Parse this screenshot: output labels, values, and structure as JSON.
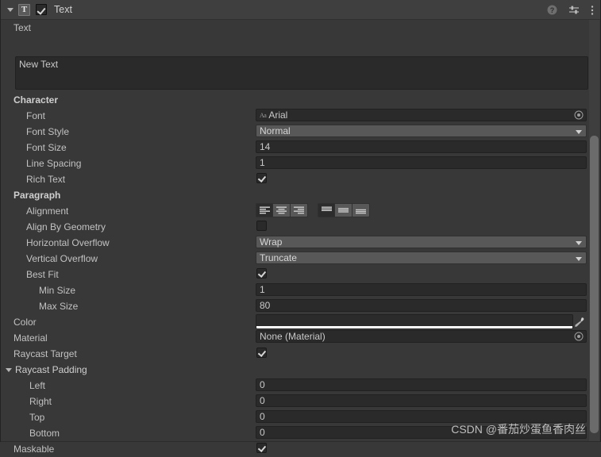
{
  "component": {
    "title": "Text",
    "icon_label": "T",
    "enabled": true,
    "expanded": true,
    "header_icons": [
      "help-icon",
      "preset-icon",
      "more-options-icon"
    ]
  },
  "text_block": {
    "label": "Text",
    "value": "New Text"
  },
  "sections": {
    "character": {
      "title": "Character",
      "font": {
        "label": "Font",
        "value": "Arial",
        "icon": "font-asset-icon"
      },
      "font_style": {
        "label": "Font Style",
        "value": "Normal"
      },
      "font_size": {
        "label": "Font Size",
        "value": "14"
      },
      "line_spacing": {
        "label": "Line Spacing",
        "value": "1"
      },
      "rich_text": {
        "label": "Rich Text",
        "checked": true
      }
    },
    "paragraph": {
      "title": "Paragraph",
      "alignment": {
        "label": "Alignment",
        "horizontal_options": [
          "align-left",
          "align-center",
          "align-right"
        ],
        "horizontal_selected": 0,
        "vertical_options": [
          "align-top",
          "align-middle",
          "align-bottom"
        ],
        "vertical_selected": 0
      },
      "align_by_geometry": {
        "label": "Align By Geometry",
        "checked": false
      },
      "horizontal_overflow": {
        "label": "Horizontal Overflow",
        "value": "Wrap"
      },
      "vertical_overflow": {
        "label": "Vertical Overflow",
        "value": "Truncate"
      },
      "best_fit": {
        "label": "Best Fit",
        "checked": true
      },
      "min_size": {
        "label": "Min Size",
        "value": "1"
      },
      "max_size": {
        "label": "Max Size",
        "value": "80"
      }
    },
    "appearance": {
      "color": {
        "label": "Color",
        "swatch_hex": "#2b2b2b",
        "alpha_hex": "#ffffff"
      },
      "material": {
        "label": "Material",
        "value": "None (Material)"
      },
      "raycast_target": {
        "label": "Raycast Target",
        "checked": true
      },
      "raycast_padding": {
        "label": "Raycast Padding",
        "expanded": true,
        "fields": [
          {
            "label": "Left",
            "value": "0"
          },
          {
            "label": "Right",
            "value": "0"
          },
          {
            "label": "Top",
            "value": "0"
          },
          {
            "label": "Bottom",
            "value": "0"
          }
        ]
      },
      "maskable": {
        "label": "Maskable",
        "checked": true
      }
    }
  },
  "watermark": {
    "text": "CSDN @番茄炒蛋鱼香肉丝"
  },
  "theme": {
    "background": "#383838",
    "header_bg": "#3f3f3f",
    "field_bg": "#2a2a2a",
    "popup_bg": "#585858",
    "text": "#c4c4c4"
  }
}
